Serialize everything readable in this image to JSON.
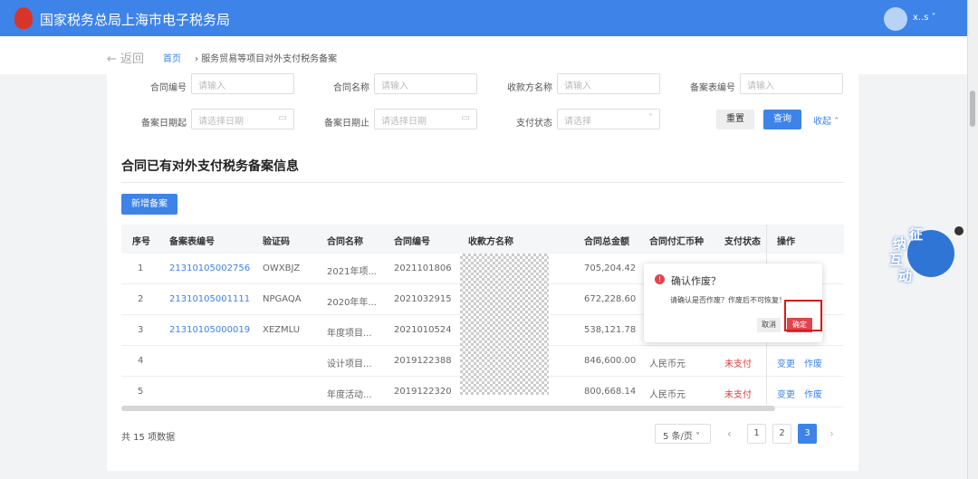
{
  "header": {
    "title": "国家税务总局上海市电子税务局",
    "user": "x..s"
  },
  "nav": {
    "back": "← 返回",
    "home": "首页",
    "separator": "›",
    "current": "服务贸易等项目对外支付税务备案"
  },
  "filters": {
    "contract_no": {
      "label": "合同编号",
      "placeholder": "请输入"
    },
    "contract_name": {
      "label": "合同名称",
      "placeholder": "请输入"
    },
    "payee": {
      "label": "收款方名称",
      "placeholder": "请输入"
    },
    "record_no": {
      "label": "备案表编号",
      "placeholder": "请输入"
    },
    "date_from": {
      "label": "备案日期起",
      "placeholder": "请选择日期"
    },
    "date_to": {
      "label": "备案日期止",
      "placeholder": "请选择日期"
    },
    "pay_status": {
      "label": "支付状态",
      "placeholder": "请选择"
    },
    "reset": "重置",
    "query": "查询",
    "collapse": "收起 ˄"
  },
  "section_title": "合同已有对外支付税务备案信息",
  "add_button": "新增备案",
  "table": {
    "columns": [
      "序号",
      "备案表编号",
      "验证码",
      "合同名称",
      "合同编号",
      "收款方名称",
      "合同总金额",
      "合同付汇币种",
      "支付状态",
      "操作"
    ],
    "rows": [
      {
        "idx": "1",
        "record": "21310105002756",
        "code": "OWXBJZ",
        "name": "2021年项...",
        "no": "2021101806",
        "amount": "705,204.42",
        "currency": "",
        "status": "",
        "a1": "",
        "a2": ""
      },
      {
        "idx": "2",
        "record": "21310105001111",
        "code": "NPGAQA",
        "name": "2020年年...",
        "no": "2021032915",
        "amount": "672,228.60",
        "currency": "",
        "status": "",
        "a1": "",
        "a2": ""
      },
      {
        "idx": "3",
        "record": "21310105000019",
        "code": "XEZMLU",
        "name": "年度项目...",
        "no": "2021010524",
        "amount": "538,121.78",
        "currency": "",
        "status": "",
        "a1": "",
        "a2": ""
      },
      {
        "idx": "4",
        "record": "",
        "code": "",
        "name": "设计项目...",
        "no": "2019122388",
        "amount": "846,600.00",
        "currency": "人民币元",
        "status": "未支付",
        "a1": "变更",
        "a2": "作废"
      },
      {
        "idx": "5",
        "record": "",
        "code": "",
        "name": "年度活动...",
        "no": "2019122320",
        "amount": "800,668.14",
        "currency": "人民币元",
        "status": "未支付",
        "a1": "变更",
        "a2": "作废"
      }
    ]
  },
  "popup": {
    "title": "确认作废？",
    "message": "请确认是否作废？作废后不可恢复！",
    "cancel": "取消",
    "ok": "确定",
    "icon": "!"
  },
  "pagination": {
    "total": "共 15 项数据",
    "page_size": "5 条/页 ˅",
    "prev": "‹",
    "next": "›",
    "pages": [
      "1",
      "2",
      "3"
    ],
    "current": "3"
  },
  "mascot": {
    "chars": [
      "征",
      "纳",
      "互",
      "动"
    ]
  }
}
